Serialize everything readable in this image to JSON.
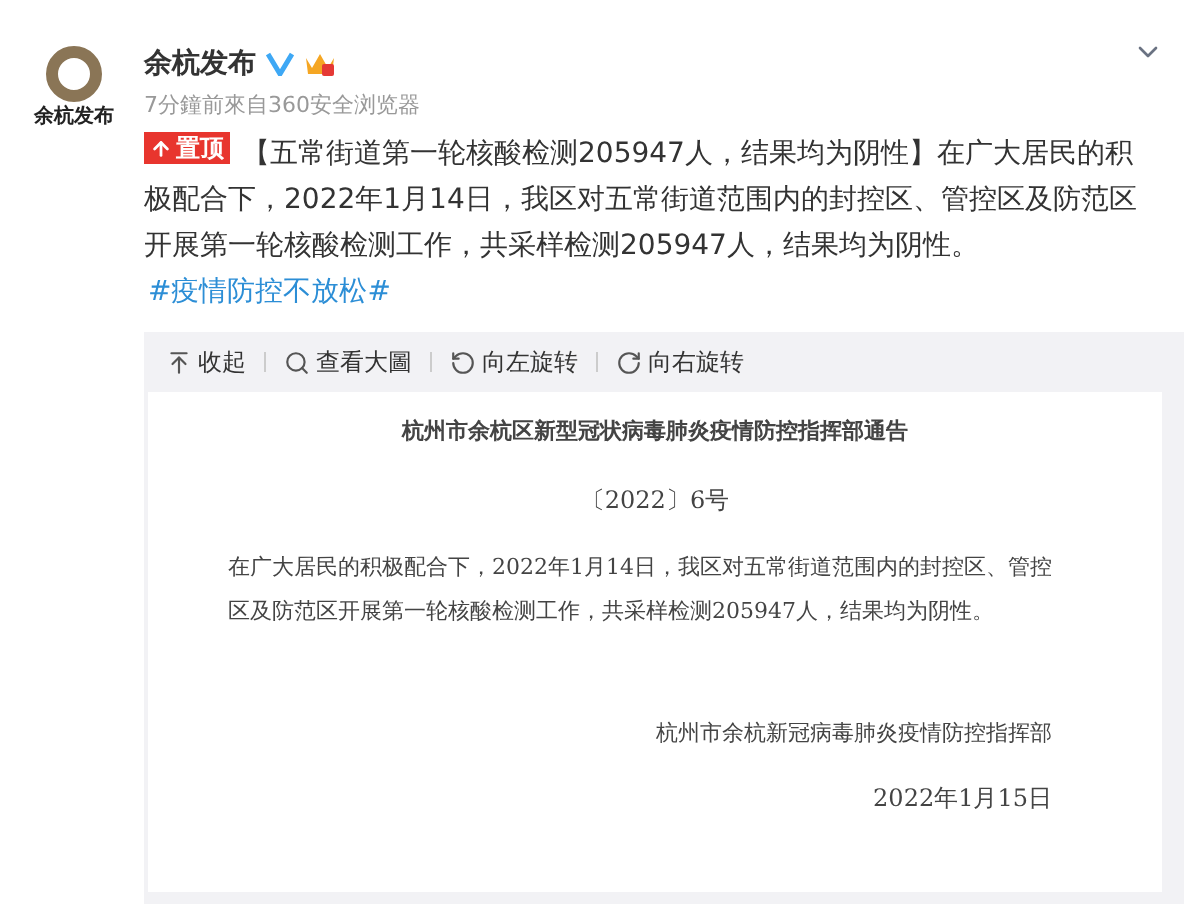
{
  "post": {
    "avatar_text": "余杭发布",
    "author": "余杭发布",
    "verified": true,
    "meta": "7分鐘前來自360安全浏览器",
    "pinned_badge": "置顶",
    "text": "【五常街道第一轮核酸检测205947人，结果均为阴性】在广大居民的积极配合下，2022年1月14日，我区对五常街道范围内的封控区、管控区及防范区开展第一轮核酸检测工作，共采样检测205947人，结果均为阴性。",
    "hashtag": "#疫情防控不放松#"
  },
  "image_toolbar": [
    {
      "kind": "collapse",
      "label": "收起"
    },
    {
      "kind": "zoom",
      "label": "查看大圖"
    },
    {
      "kind": "rotate-left",
      "label": "向左旋转"
    },
    {
      "kind": "rotate-right",
      "label": "向右旋转"
    }
  ],
  "document": {
    "title": "杭州市余杭区新型冠状病毒肺炎疫情防控指挥部通告",
    "number": "〔2022〕6号",
    "body": "在广大居民的积极配合下，2022年1月14日，我区对五常街道范围内的封控区、管控区及防范区开展第一轮核酸检测工作，共采样检测205947人，结果均为阴性。",
    "signature": "杭州市余杭新冠病毒肺炎疫情防控指挥部",
    "date": "2022年1月15日"
  }
}
